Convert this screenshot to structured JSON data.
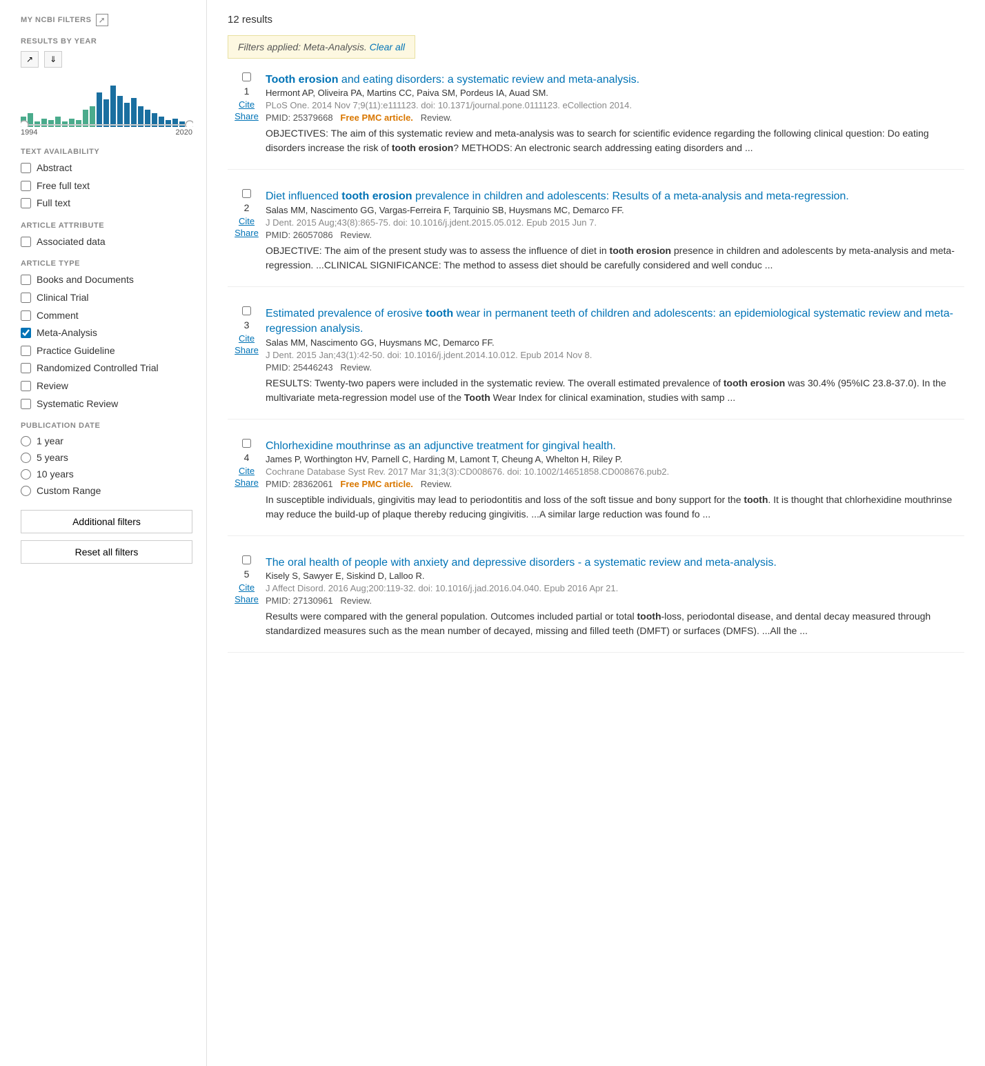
{
  "sidebar": {
    "my_ncbi_label": "MY NCBI FILTERS",
    "results_by_year_label": "RESULTS BY YEAR",
    "chart": {
      "year_start": "1994",
      "year_end": "2020"
    },
    "text_availability": {
      "label": "TEXT AVAILABILITY",
      "items": [
        {
          "id": "abstract",
          "label": "Abstract",
          "checked": false
        },
        {
          "id": "free_full_text",
          "label": "Free full text",
          "checked": false
        },
        {
          "id": "full_text",
          "label": "Full text",
          "checked": false
        }
      ]
    },
    "article_attribute": {
      "label": "ARTICLE ATTRIBUTE",
      "items": [
        {
          "id": "associated_data",
          "label": "Associated data",
          "checked": false
        }
      ]
    },
    "article_type": {
      "label": "ARTICLE TYPE",
      "items": [
        {
          "id": "books_documents",
          "label": "Books and Documents",
          "checked": false
        },
        {
          "id": "clinical_trial",
          "label": "Clinical Trial",
          "checked": false
        },
        {
          "id": "comment",
          "label": "Comment",
          "checked": false
        },
        {
          "id": "meta_analysis",
          "label": "Meta-Analysis",
          "checked": true
        },
        {
          "id": "practice_guideline",
          "label": "Practice Guideline",
          "checked": false
        },
        {
          "id": "randomized_controlled_trial",
          "label": "Randomized Controlled Trial",
          "checked": false
        },
        {
          "id": "review",
          "label": "Review",
          "checked": false
        },
        {
          "id": "systematic_review",
          "label": "Systematic Review",
          "checked": false
        }
      ]
    },
    "publication_date": {
      "label": "PUBLICATION DATE",
      "items": [
        {
          "id": "1year",
          "label": "1 year",
          "checked": false
        },
        {
          "id": "5years",
          "label": "5 years",
          "checked": false
        },
        {
          "id": "10years",
          "label": "10 years",
          "checked": false
        },
        {
          "id": "custom_range",
          "label": "Custom Range",
          "checked": false
        }
      ]
    },
    "additional_filters_btn": "Additional filters",
    "reset_filters_btn": "Reset all filters"
  },
  "main": {
    "results_count": "12 results",
    "filters_applied_text": "Filters applied: Meta-Analysis.",
    "clear_all_label": "Clear all",
    "results": [
      {
        "number": "1",
        "checkbox": false,
        "title_parts": [
          {
            "text": "Tooth erosion",
            "bold": true,
            "link": true
          },
          {
            "text": " and eating disorders: a systematic review and meta-analysis.",
            "bold": false,
            "link": true
          }
        ],
        "authors": "Hermont AP, Oliveira PA, Martins CC, Paiva SM, Pordeus IA, Auad SM.",
        "journal": "PLoS One. 2014 Nov 7;9(11):e111123. doi: 10.1371/journal.pone.0111123. eCollection 2014.",
        "pmid": "PMID: 25379668",
        "free_pmc": true,
        "free_pmc_label": "Free PMC article.",
        "review_tag": "Review.",
        "abstract": "OBJECTIVES: The aim of this systematic review and meta-analysis was to search for scientific evidence regarding the following clinical question: Do eating disorders increase the risk of tooth erosion? METHODS: An electronic search addressing eating disorders and ...",
        "abstract_bold": [
          "tooth erosion"
        ]
      },
      {
        "number": "2",
        "checkbox": false,
        "title_parts": [
          {
            "text": "Diet influenced ",
            "bold": false,
            "link": true
          },
          {
            "text": "tooth erosion",
            "bold": true,
            "link": true
          },
          {
            "text": " prevalence in children and adolescents: Results of a meta-analysis and meta-regression.",
            "bold": false,
            "link": true
          }
        ],
        "authors": "Salas MM, Nascimento GG, Vargas-Ferreira F, Tarquinio SB, Huysmans MC, Demarco FF.",
        "journal": "J Dent. 2015 Aug;43(8):865-75. doi: 10.1016/j.jdent.2015.05.012. Epub 2015 Jun 7.",
        "pmid": "PMID: 26057086",
        "free_pmc": false,
        "review_tag": "Review.",
        "abstract": "OBJECTIVE: The aim of the present study was to assess the influence of diet in tooth erosion presence in children and adolescents by meta-analysis and meta-regression. ...CLINICAL SIGNIFICANCE: The method to assess diet should be carefully considered and well conduc ...",
        "abstract_bold": [
          "tooth erosion"
        ]
      },
      {
        "number": "3",
        "checkbox": false,
        "title_parts": [
          {
            "text": "Estimated prevalence of erosive ",
            "bold": false,
            "link": true
          },
          {
            "text": "tooth",
            "bold": true,
            "link": true
          },
          {
            "text": " wear in permanent teeth of children and adolescents: an epidemiological systematic review and meta-regression analysis.",
            "bold": false,
            "link": true
          }
        ],
        "authors": "Salas MM, Nascimento GG, Huysmans MC, Demarco FF.",
        "journal": "J Dent. 2015 Jan;43(1):42-50. doi: 10.1016/j.jdent.2014.10.012. Epub 2014 Nov 8.",
        "pmid": "PMID: 25446243",
        "free_pmc": false,
        "review_tag": "Review.",
        "abstract": "RESULTS: Twenty-two papers were included in the systematic review. The overall estimated prevalence of tooth erosion was 30.4% (95%IC 23.8-37.0). In the multivariate meta-regression model use of the Tooth Wear Index for clinical examination, studies with samp ...",
        "abstract_bold": [
          "tooth erosion",
          "Tooth"
        ]
      },
      {
        "number": "4",
        "checkbox": false,
        "title_parts": [
          {
            "text": "Chlorhexidine mouthrinse as an adjunctive treatment for gingival health.",
            "bold": false,
            "link": true
          }
        ],
        "authors": "James P, Worthington HV, Parnell C, Harding M, Lamont T, Cheung A, Whelton H, Riley P.",
        "journal": "Cochrane Database Syst Rev. 2017 Mar 31;3(3):CD008676. doi: 10.1002/14651858.CD008676.pub2.",
        "pmid": "PMID: 28362061",
        "free_pmc": true,
        "free_pmc_label": "Free PMC article.",
        "review_tag": "Review.",
        "abstract": "In susceptible individuals, gingivitis may lead to periodontitis and loss of the soft tissue and bony support for the tooth. It is thought that chlorhexidine mouthrinse may reduce the build-up of plaque thereby reducing gingivitis. ...A similar large reduction was found fo ...",
        "abstract_bold": [
          "tooth"
        ]
      },
      {
        "number": "5",
        "checkbox": false,
        "title_parts": [
          {
            "text": "The oral health of people with anxiety and depressive disorders - a systematic review and meta-analysis.",
            "bold": false,
            "link": true
          }
        ],
        "authors": "Kisely S, Sawyer E, Siskind D, Lalloo R.",
        "journal": "J Affect Disord. 2016 Aug;200:119-32. doi: 10.1016/j.jad.2016.04.040. Epub 2016 Apr 21.",
        "pmid": "PMID: 27130961",
        "free_pmc": false,
        "review_tag": "Review.",
        "abstract": "Results were compared with the general population. Outcomes included partial or total tooth-loss, periodontal disease, and dental decay measured through standardized measures such as the mean number of decayed, missing and filled teeth (DMFT) or surfaces (DMFS). ...All the ...",
        "abstract_bold": [
          "tooth"
        ]
      }
    ]
  }
}
